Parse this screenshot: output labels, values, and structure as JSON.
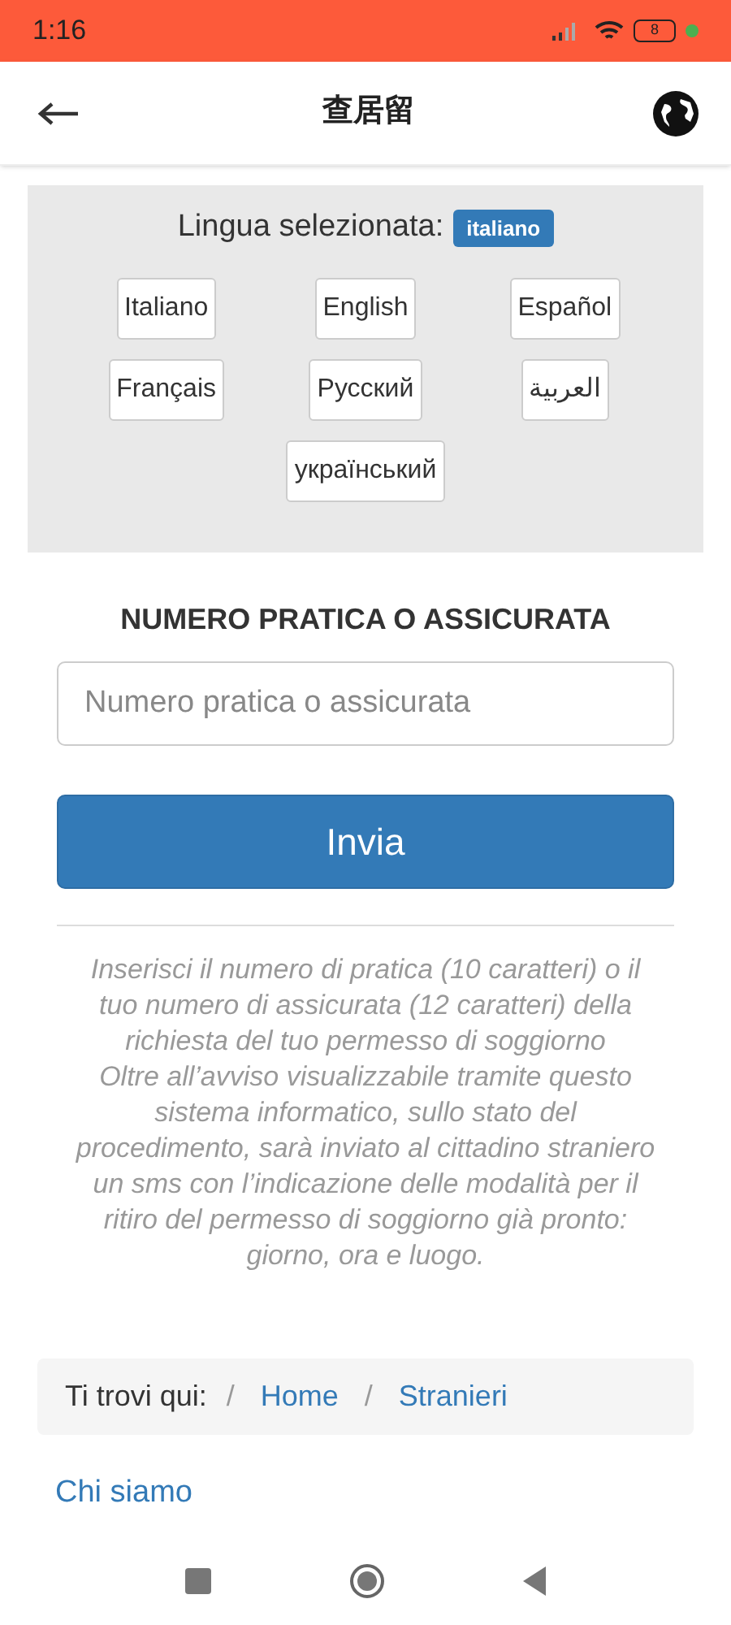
{
  "status_bar": {
    "time": "1:16",
    "battery": "8"
  },
  "app_bar": {
    "title": "查居留"
  },
  "language_panel": {
    "label": "Lingua selezionata:",
    "badge": "italiano",
    "languages": [
      {
        "label": "Italiano"
      },
      {
        "label": "English"
      },
      {
        "label": "Español"
      },
      {
        "label": "Français"
      },
      {
        "label": "Русский"
      },
      {
        "label": "العربية"
      },
      {
        "label": "український"
      }
    ]
  },
  "form": {
    "heading": "NUMERO PRATICA O ASSICURATA",
    "placeholder": "Numero pratica o assicurata",
    "submit": "Invia"
  },
  "help": [
    "Inserisci il numero di pratica (10 caratteri) o il tuo numero di assicurata (12 caratteri) della richiesta del tuo permesso di soggiorno",
    "Oltre all’avviso visualizzabile tramite questo sistema informatico, sullo stato del procedimento, sarà inviato al cittadino straniero un sms con l’indicazione delle modalità per il ritiro del permesso di soggiorno già pronto: giorno, ora e luogo."
  ],
  "breadcrumb": {
    "label": "Ti trovi qui:",
    "separators": [
      "/",
      "/"
    ],
    "items": [
      "Home",
      "Stranieri"
    ]
  },
  "footer_link": "Chi siamo"
}
